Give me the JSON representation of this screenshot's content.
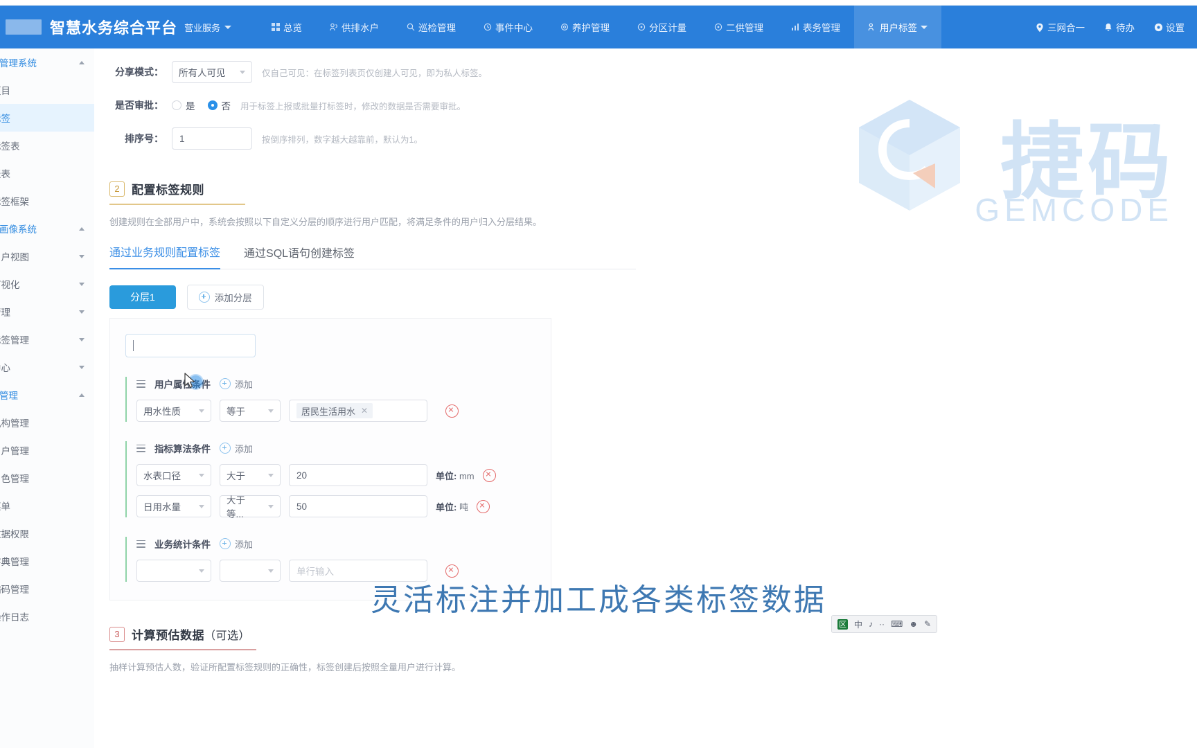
{
  "topnav": {
    "brand": "智慧水务综合平台",
    "subsystem": "营业服务",
    "items": [
      {
        "label": "总览",
        "icon": "grid-icon"
      },
      {
        "label": "供排水户",
        "icon": "users-icon"
      },
      {
        "label": "巡检管理",
        "icon": "search-icon"
      },
      {
        "label": "事件中心",
        "icon": "clock-icon"
      },
      {
        "label": "养护管理",
        "icon": "gear-icon"
      },
      {
        "label": "分区计量",
        "icon": "target-icon"
      },
      {
        "label": "二供管理",
        "icon": "target-icon"
      },
      {
        "label": "表务管理",
        "icon": "bars-icon"
      },
      {
        "label": "用户标签",
        "icon": "person-tag-icon"
      }
    ],
    "right": [
      {
        "label": "三网合一",
        "icon": "location-icon"
      },
      {
        "label": "待办",
        "icon": "bell-icon"
      },
      {
        "label": "设置",
        "icon": "gear-icon"
      }
    ]
  },
  "sidebar": {
    "groups": [
      {
        "label": "标签管理系统",
        "state": "expanded"
      },
      {
        "label": "项目",
        "state": "item"
      },
      {
        "label": "标签",
        "state": "item-selected"
      },
      {
        "label": "标签表",
        "state": "item"
      },
      {
        "label": "报表",
        "state": "item"
      },
      {
        "label": "标签框架",
        "state": "item"
      },
      {
        "label": "标签画像系统",
        "state": "expanded"
      },
      {
        "label": "用户视图",
        "state": "collapsed"
      },
      {
        "label": "可视化",
        "state": "collapsed"
      },
      {
        "label": "管理",
        "state": "collapsed"
      },
      {
        "label": "标签管理",
        "state": "collapsed"
      },
      {
        "label": "中心",
        "state": "collapsed"
      },
      {
        "label": "系统管理",
        "state": "expanded"
      },
      {
        "label": "机构管理",
        "state": "item"
      },
      {
        "label": "用户管理",
        "state": "item"
      },
      {
        "label": "角色管理",
        "state": "item"
      },
      {
        "label": "菜单",
        "state": "item"
      },
      {
        "label": "数据权限",
        "state": "item"
      },
      {
        "label": "字典管理",
        "state": "item"
      },
      {
        "label": "编码管理",
        "state": "item"
      },
      {
        "label": "操作日志",
        "state": "item"
      }
    ]
  },
  "form": {
    "share_mode": {
      "label": "分享模式：",
      "value": "所有人可见",
      "hint": "仅自己可见：在标签列表页仅创建人可见，即为私人标签。"
    },
    "approval": {
      "label": "是否审批：",
      "yes": "是",
      "no": "否",
      "selected": "否",
      "hint": "用于标签上报或批量打标签时，修改的数据是否需要审批。"
    },
    "sort_no": {
      "label": "排序号：",
      "value": "1",
      "hint": "按倒序排列，数字越大越靠前，默认为1。"
    }
  },
  "section2": {
    "number": "2",
    "title": "配置标签规则",
    "desc": "创建规则在全部用户中，系统会按照以下自定义分层的顺序进行用户匹配，将满足条件的用户归入分层结果。",
    "tabs": [
      {
        "label": "通过业务规则配置标签",
        "active": true
      },
      {
        "label": "通过SQL语句创建标签",
        "active": false
      }
    ],
    "layer_button": "分层1",
    "add_layer_button": "添加分层",
    "layer_name_value": "",
    "condition_groups": [
      {
        "title": "用户属性条件",
        "add_label": "添加",
        "rows": [
          {
            "field": "用水性质",
            "operator": "等于",
            "value_tag": "居民生活用水",
            "value_text": "",
            "placeholder": "",
            "unit_label": "",
            "unit_value": ""
          }
        ]
      },
      {
        "title": "指标算法条件",
        "add_label": "添加",
        "rows": [
          {
            "field": "水表口径",
            "operator": "大于",
            "value_tag": "",
            "value_text": "20",
            "placeholder": "",
            "unit_label": "单位:",
            "unit_value": "mm"
          },
          {
            "field": "日用水量",
            "operator": "大于等...",
            "value_tag": "",
            "value_text": "50",
            "placeholder": "",
            "unit_label": "单位:",
            "unit_value": "吨"
          }
        ]
      },
      {
        "title": "业务统计条件",
        "add_label": "添加",
        "rows": [
          {
            "field": "",
            "operator": "",
            "value_tag": "",
            "value_text": "",
            "placeholder": "单行输入",
            "unit_label": "",
            "unit_value": ""
          }
        ]
      }
    ]
  },
  "section3": {
    "number": "3",
    "title": "计算预估数据",
    "optional": "（可选）",
    "desc": "抽样计算预估人数，验证所配置标签规则的正确性，标签创建后按照全量用户进行计算。"
  },
  "watermark": {
    "cn": "捷码",
    "en": "GEMCODE"
  },
  "subtitle": "灵活标注并加工成各类标签数据",
  "ime": {
    "lang": "中",
    "items": [
      "中",
      "⌁",
      "⋯",
      "⌨",
      "☺",
      "🔧"
    ]
  }
}
